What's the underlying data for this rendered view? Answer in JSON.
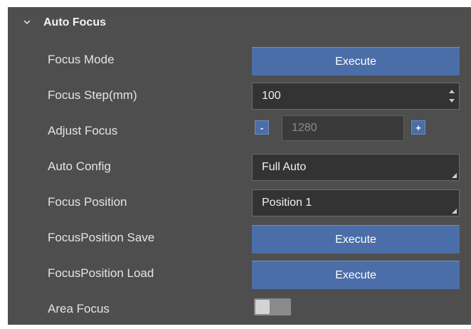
{
  "section": {
    "title": "Auto Focus",
    "expanded": true
  },
  "rows": {
    "focus_mode": {
      "label": "Focus Mode",
      "button": "Execute"
    },
    "focus_step": {
      "label": "Focus Step(mm)",
      "value": "100"
    },
    "adjust_focus": {
      "label": "Adjust Focus",
      "value": "1280",
      "minus": "-",
      "plus": "+"
    },
    "auto_config": {
      "label": "Auto Config",
      "value": "Full Auto"
    },
    "focus_position": {
      "label": "Focus Position",
      "value": "Position 1"
    },
    "focus_position_save": {
      "label": "FocusPosition Save",
      "button": "Execute"
    },
    "focus_position_load": {
      "label": "FocusPosition Load",
      "button": "Execute"
    },
    "area_focus": {
      "label": "Area Focus",
      "enabled": false
    }
  },
  "colors": {
    "panel_bg": "#4e4e4e",
    "accent": "#4b6ea8",
    "field_bg": "#333333"
  },
  "icons": {
    "section_toggle": "chevron-down-icon",
    "spin": "spin-arrows-icon",
    "dropdown": "dropdown-corner-icon"
  }
}
